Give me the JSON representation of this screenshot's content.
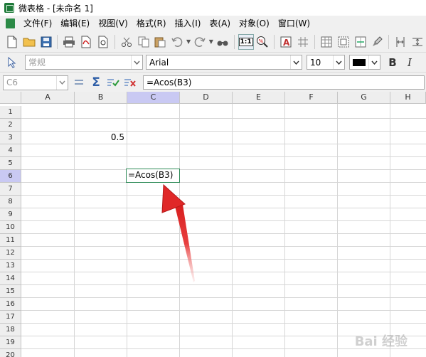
{
  "window": {
    "title": "微表格 - [未命名 1]"
  },
  "menu": [
    "文件(F)",
    "编辑(E)",
    "视图(V)",
    "格式(R)",
    "插入(I)",
    "表(A)",
    "对象(O)",
    "窗口(W)"
  ],
  "toolbar2": {
    "style_value": "常规",
    "font_value": "Arial",
    "size_value": "10"
  },
  "formula": {
    "cell_ref": "C6",
    "content": "=Acos(B3)"
  },
  "sheet": {
    "columns": [
      "A",
      "B",
      "C",
      "D",
      "E",
      "F",
      "G",
      "H"
    ],
    "active_column": "C",
    "rows": [
      "1",
      "2",
      "3",
      "4",
      "5",
      "6",
      "7",
      "8",
      "9",
      "10",
      "11",
      "12",
      "13",
      "14",
      "15",
      "16",
      "17",
      "18",
      "19",
      "20"
    ],
    "active_row": "6",
    "b3_value": "0.5",
    "c6_value": "=Acos(B3)"
  },
  "colors": {
    "selection_border": "#2e8b57",
    "header_active": "#c9c9f3",
    "arrow": "#e53030"
  },
  "watermark": "Bai 经验"
}
